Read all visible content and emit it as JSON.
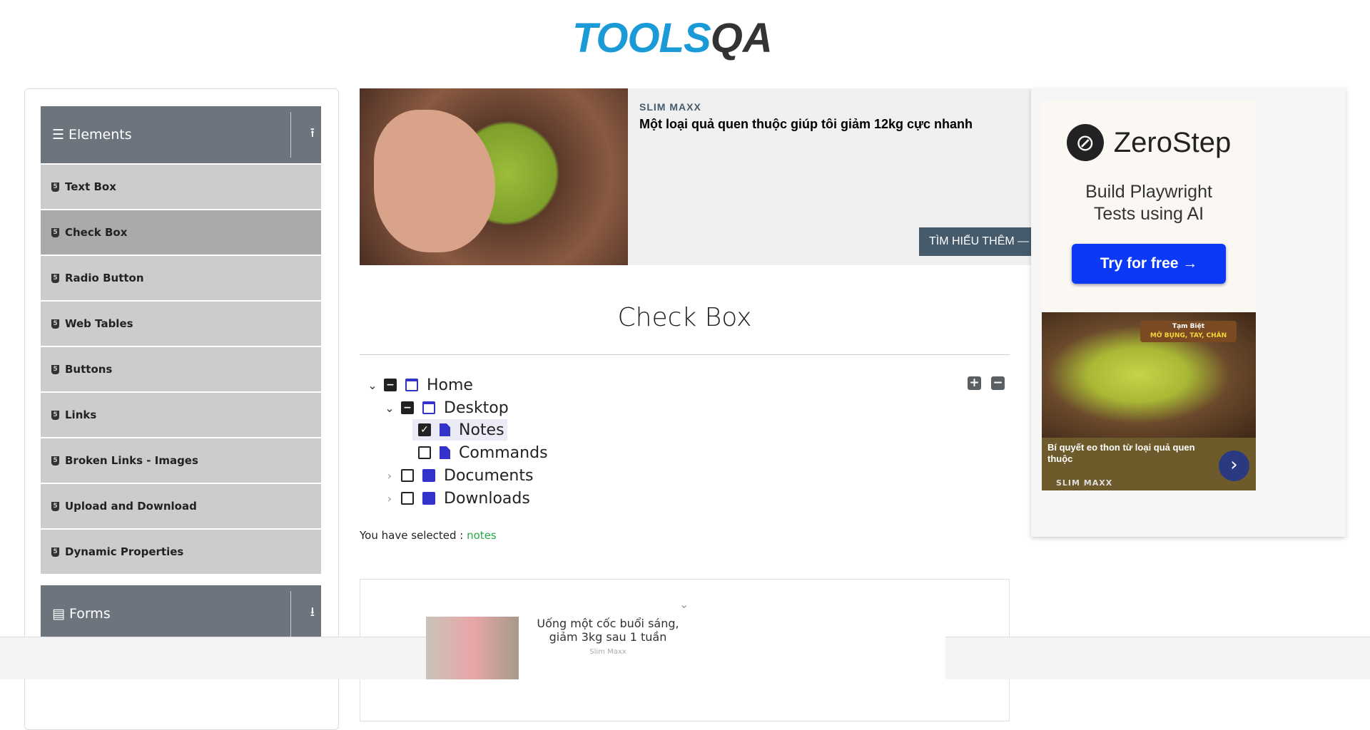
{
  "logo": {
    "text_a": "TOOLS",
    "text_b": "QA"
  },
  "sidebar": {
    "groups": [
      {
        "label": "Elements",
        "icon": "arrow-up-icon"
      },
      {
        "label": "Forms",
        "icon": "arrow-down-icon"
      }
    ],
    "items": [
      {
        "label": "Text Box"
      },
      {
        "label": "Check Box",
        "active": true
      },
      {
        "label": "Radio Button"
      },
      {
        "label": "Web Tables"
      },
      {
        "label": "Buttons"
      },
      {
        "label": "Links"
      },
      {
        "label": "Broken Links - Images"
      },
      {
        "label": "Upload and Download"
      },
      {
        "label": "Dynamic Properties"
      }
    ]
  },
  "top_ad": {
    "brand": "SLIM MAXX",
    "headline": "Một loại quả quen thuộc giúp tôi giảm 12kg cực nhanh",
    "cta": "TÌM HIỂU THÊM —"
  },
  "main": {
    "title": "Check Box",
    "tree": [
      {
        "label": "Home",
        "state": "partial",
        "expanded": true
      },
      {
        "label": "Desktop",
        "state": "partial",
        "expanded": true
      },
      {
        "label": "Notes",
        "state": "checked"
      },
      {
        "label": "Commands",
        "state": "unchecked"
      },
      {
        "label": "Documents",
        "state": "unchecked",
        "expanded": false
      },
      {
        "label": "Downloads",
        "state": "unchecked",
        "expanded": false
      }
    ],
    "expand_all": "+",
    "collapse_all": "−",
    "selected_label": "You have selected :",
    "selected_value": "notes"
  },
  "bottom_ad": {
    "headline": "Uống một cốc buổi sáng, giảm 3kg sau 1 tuần",
    "brand": "Slim Maxx"
  },
  "right_ad": {
    "zerostep": {
      "brand": "ZeroStep",
      "tagline_1": "Build Playwright",
      "tagline_2": "Tests using AI",
      "cta": "Try for free →"
    },
    "banana": {
      "badge_1": "Tạm Biệt",
      "badge_2": "MỠ BỤNG, TAY, CHÂN",
      "caption": "Bí quyết eo thon từ loại quả quen thuộc",
      "brand": "SLIM MAXX"
    }
  },
  "colors": {
    "brand_blue": "#1a9ad6",
    "sidebar_header": "#6c757d",
    "tree_icon": "#3333cc",
    "selected_value": "#28a745"
  }
}
